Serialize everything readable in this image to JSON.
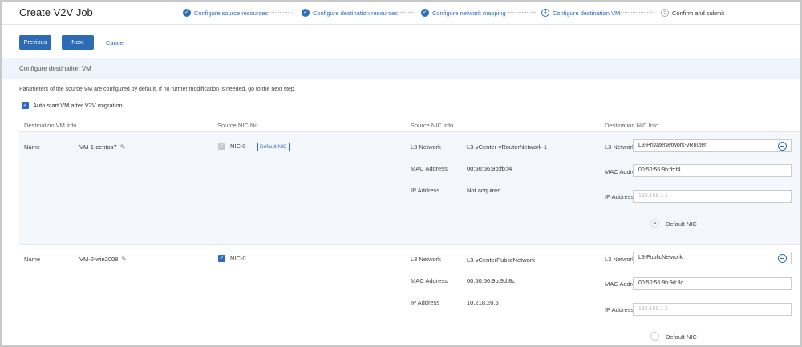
{
  "title": "Create V2V Job",
  "steps": [
    {
      "label": "Configure source resources",
      "state": "done"
    },
    {
      "label": "Configure destination resources",
      "state": "done"
    },
    {
      "label": "Configure network mapping",
      "state": "done"
    },
    {
      "label": "Configure destination VM",
      "state": "current",
      "number": "4"
    },
    {
      "label": "Confirm and submit",
      "state": "pending",
      "number": "5"
    }
  ],
  "actions": {
    "previous": "Previous",
    "next": "Next",
    "cancel": "Cancel"
  },
  "section_title": "Configure destination VM",
  "description": "Parameters of the source VM are configured by default. If no further modification is needed, go to the next step.",
  "auto_start": {
    "label": "Auto start VM after V2V migration",
    "checked": true
  },
  "columns": [
    "Destination VM Info",
    "Source NIC No.",
    "Source NIC Info",
    "Destination NIC Info"
  ],
  "rows": [
    {
      "name_label": "Name",
      "vm_name": "VM-1-centos7",
      "nic": "NIC-0",
      "nic_checked_disabled": true,
      "default_nic_tag": "Default NIC",
      "src": {
        "l3_label": "L3 Network",
        "l3": "L3-vCenter-vRouterNetwork-1",
        "mac_label": "MAC Address",
        "mac": "00:50:56:9b:fb:f4",
        "ip_label": "IP Address",
        "ip": "Not acquired"
      },
      "dst": {
        "l3_label": "L3 Network *",
        "l3": "L3-PrivateNetwork-vRouter",
        "mac_label": "MAC Address",
        "mac": "00:50:56:9b:fb:f4",
        "ip_label": "IP Address",
        "ip_placeholder": "192.168.1.1",
        "default_label": "Default NIC",
        "default_selected": true
      }
    },
    {
      "name_label": "Name",
      "vm_name": "VM-2-win2008",
      "nic": "NIC-0",
      "nic_checked_disabled": false,
      "src": {
        "l3_label": "L3 Network",
        "l3": "L3-vCenterPublicNetwork",
        "mac_label": "MAC Address",
        "mac": "00:50:56:9b:9d:8c",
        "ip_label": "IP Address",
        "ip": "10.218.20.6"
      },
      "dst": {
        "l3_label": "L3 Network *",
        "l3": "L3-PublicNetwork",
        "mac_label": "MAC Address",
        "mac": "00:50:56:9b:9d:8c",
        "ip_label": "IP Address",
        "ip_placeholder": "192.168.1.1",
        "default_label": "Default NIC",
        "default_selected": false
      }
    }
  ],
  "colors": {
    "accent": "#2a6cbf",
    "button": "#2d6bb5",
    "section_bg": "#edf4fb"
  }
}
